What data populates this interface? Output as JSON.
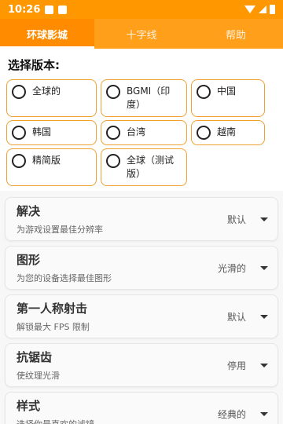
{
  "status_bar": {
    "time": "10:26"
  },
  "tabs": [
    {
      "label": "环球影城",
      "active": true
    },
    {
      "label": "十字线",
      "active": false
    },
    {
      "label": "帮助",
      "active": false
    }
  ],
  "version_section": {
    "title": "选择版本:",
    "options": [
      {
        "label": "全球的"
      },
      {
        "label": "BGMI（印度）"
      },
      {
        "label": "中国"
      },
      {
        "label": "韩国"
      },
      {
        "label": "台湾"
      },
      {
        "label": "越南"
      },
      {
        "label": "精简版"
      },
      {
        "label": "全球（测试版）"
      }
    ]
  },
  "settings": [
    {
      "title": "解决",
      "subtitle": "为游戏设置最佳分辨率",
      "value": "默认"
    },
    {
      "title": "图形",
      "subtitle": "为您的设备选择最佳图形",
      "value": "光滑的"
    },
    {
      "title": "第一人称射击",
      "subtitle": "解锁最大 FPS 限制",
      "value": "默认"
    },
    {
      "title": "抗锯齿",
      "subtitle": "使纹理光滑",
      "value": "停用"
    },
    {
      "title": "样式",
      "subtitle": "选择你最喜欢的滤镜",
      "value": "经典的"
    }
  ],
  "colors": {
    "accent": "#ff9800",
    "tab_active": "#ff8c00",
    "option_border": "#f0a030"
  }
}
